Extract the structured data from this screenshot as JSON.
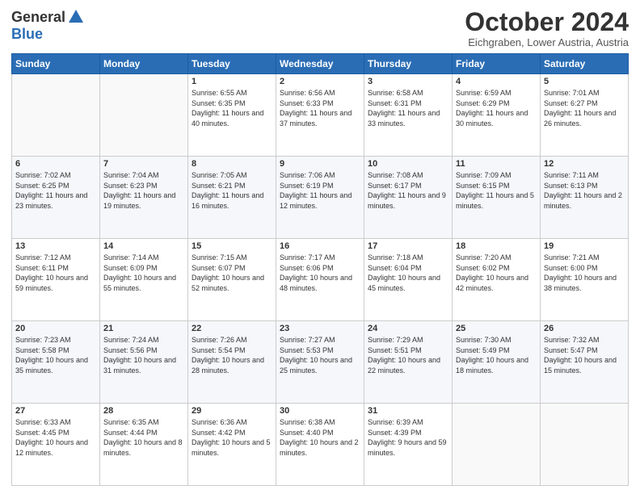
{
  "header": {
    "logo_general": "General",
    "logo_blue": "Blue",
    "main_title": "October 2024",
    "subtitle": "Eichgraben, Lower Austria, Austria"
  },
  "days_of_week": [
    "Sunday",
    "Monday",
    "Tuesday",
    "Wednesday",
    "Thursday",
    "Friday",
    "Saturday"
  ],
  "weeks": [
    [
      {
        "day": "",
        "detail": ""
      },
      {
        "day": "",
        "detail": ""
      },
      {
        "day": "1",
        "detail": "Sunrise: 6:55 AM\nSunset: 6:35 PM\nDaylight: 11 hours and 40 minutes."
      },
      {
        "day": "2",
        "detail": "Sunrise: 6:56 AM\nSunset: 6:33 PM\nDaylight: 11 hours and 37 minutes."
      },
      {
        "day": "3",
        "detail": "Sunrise: 6:58 AM\nSunset: 6:31 PM\nDaylight: 11 hours and 33 minutes."
      },
      {
        "day": "4",
        "detail": "Sunrise: 6:59 AM\nSunset: 6:29 PM\nDaylight: 11 hours and 30 minutes."
      },
      {
        "day": "5",
        "detail": "Sunrise: 7:01 AM\nSunset: 6:27 PM\nDaylight: 11 hours and 26 minutes."
      }
    ],
    [
      {
        "day": "6",
        "detail": "Sunrise: 7:02 AM\nSunset: 6:25 PM\nDaylight: 11 hours and 23 minutes."
      },
      {
        "day": "7",
        "detail": "Sunrise: 7:04 AM\nSunset: 6:23 PM\nDaylight: 11 hours and 19 minutes."
      },
      {
        "day": "8",
        "detail": "Sunrise: 7:05 AM\nSunset: 6:21 PM\nDaylight: 11 hours and 16 minutes."
      },
      {
        "day": "9",
        "detail": "Sunrise: 7:06 AM\nSunset: 6:19 PM\nDaylight: 11 hours and 12 minutes."
      },
      {
        "day": "10",
        "detail": "Sunrise: 7:08 AM\nSunset: 6:17 PM\nDaylight: 11 hours and 9 minutes."
      },
      {
        "day": "11",
        "detail": "Sunrise: 7:09 AM\nSunset: 6:15 PM\nDaylight: 11 hours and 5 minutes."
      },
      {
        "day": "12",
        "detail": "Sunrise: 7:11 AM\nSunset: 6:13 PM\nDaylight: 11 hours and 2 minutes."
      }
    ],
    [
      {
        "day": "13",
        "detail": "Sunrise: 7:12 AM\nSunset: 6:11 PM\nDaylight: 10 hours and 59 minutes."
      },
      {
        "day": "14",
        "detail": "Sunrise: 7:14 AM\nSunset: 6:09 PM\nDaylight: 10 hours and 55 minutes."
      },
      {
        "day": "15",
        "detail": "Sunrise: 7:15 AM\nSunset: 6:07 PM\nDaylight: 10 hours and 52 minutes."
      },
      {
        "day": "16",
        "detail": "Sunrise: 7:17 AM\nSunset: 6:06 PM\nDaylight: 10 hours and 48 minutes."
      },
      {
        "day": "17",
        "detail": "Sunrise: 7:18 AM\nSunset: 6:04 PM\nDaylight: 10 hours and 45 minutes."
      },
      {
        "day": "18",
        "detail": "Sunrise: 7:20 AM\nSunset: 6:02 PM\nDaylight: 10 hours and 42 minutes."
      },
      {
        "day": "19",
        "detail": "Sunrise: 7:21 AM\nSunset: 6:00 PM\nDaylight: 10 hours and 38 minutes."
      }
    ],
    [
      {
        "day": "20",
        "detail": "Sunrise: 7:23 AM\nSunset: 5:58 PM\nDaylight: 10 hours and 35 minutes."
      },
      {
        "day": "21",
        "detail": "Sunrise: 7:24 AM\nSunset: 5:56 PM\nDaylight: 10 hours and 31 minutes."
      },
      {
        "day": "22",
        "detail": "Sunrise: 7:26 AM\nSunset: 5:54 PM\nDaylight: 10 hours and 28 minutes."
      },
      {
        "day": "23",
        "detail": "Sunrise: 7:27 AM\nSunset: 5:53 PM\nDaylight: 10 hours and 25 minutes."
      },
      {
        "day": "24",
        "detail": "Sunrise: 7:29 AM\nSunset: 5:51 PM\nDaylight: 10 hours and 22 minutes."
      },
      {
        "day": "25",
        "detail": "Sunrise: 7:30 AM\nSunset: 5:49 PM\nDaylight: 10 hours and 18 minutes."
      },
      {
        "day": "26",
        "detail": "Sunrise: 7:32 AM\nSunset: 5:47 PM\nDaylight: 10 hours and 15 minutes."
      }
    ],
    [
      {
        "day": "27",
        "detail": "Sunrise: 6:33 AM\nSunset: 4:45 PM\nDaylight: 10 hours and 12 minutes."
      },
      {
        "day": "28",
        "detail": "Sunrise: 6:35 AM\nSunset: 4:44 PM\nDaylight: 10 hours and 8 minutes."
      },
      {
        "day": "29",
        "detail": "Sunrise: 6:36 AM\nSunset: 4:42 PM\nDaylight: 10 hours and 5 minutes."
      },
      {
        "day": "30",
        "detail": "Sunrise: 6:38 AM\nSunset: 4:40 PM\nDaylight: 10 hours and 2 minutes."
      },
      {
        "day": "31",
        "detail": "Sunrise: 6:39 AM\nSunset: 4:39 PM\nDaylight: 9 hours and 59 minutes."
      },
      {
        "day": "",
        "detail": ""
      },
      {
        "day": "",
        "detail": ""
      }
    ]
  ]
}
